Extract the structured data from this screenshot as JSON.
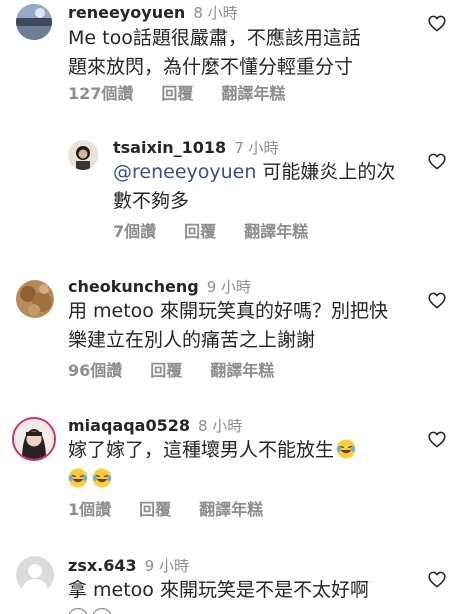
{
  "comments": [
    {
      "username": "reneeyoyuen",
      "time": "8 小時",
      "lines": [
        "Me too話題很嚴肅，不應該用這話",
        "題來放閃，為什麼不懂分輕重分寸"
      ],
      "likes": "127個讚",
      "reply": "回覆",
      "translate": "翻譯年糕"
    },
    {
      "username": "tsaixin_1018",
      "time": "7 小時",
      "mention": "@reneeyoyuen",
      "lines": [
        " 可能嫌炎上的次",
        "數不夠多"
      ],
      "likes": "7個讚",
      "reply": "回覆",
      "translate": "翻譯年糕"
    },
    {
      "username": "cheokuncheng",
      "time": "9 小時",
      "lines": [
        "用 metoo 來開玩笑真的好嗎？別把快",
        "樂建立在別人的痛苦之上謝謝"
      ],
      "likes": "96個讚",
      "reply": "回覆",
      "translate": "翻譯年糕"
    },
    {
      "username": "miaqaqa0528",
      "time": "8 小時",
      "lines": [
        "嫁了嫁了，這種壞男人不能放生"
      ],
      "likes": "1個讚",
      "reply": "回覆",
      "translate": "翻譯年糕"
    },
    {
      "username": "zsx.643",
      "time": "9 小時",
      "lines": [
        "拿 metoo 來開玩笑是不是不太好啊"
      ]
    }
  ],
  "icons": {
    "like": "heart-outline-icon",
    "emoji": "laughing-crying-emoji"
  },
  "colors": {
    "username": "#262626",
    "meta": "#8e8e8e",
    "mention": "#385185",
    "background": "#ffffff"
  }
}
